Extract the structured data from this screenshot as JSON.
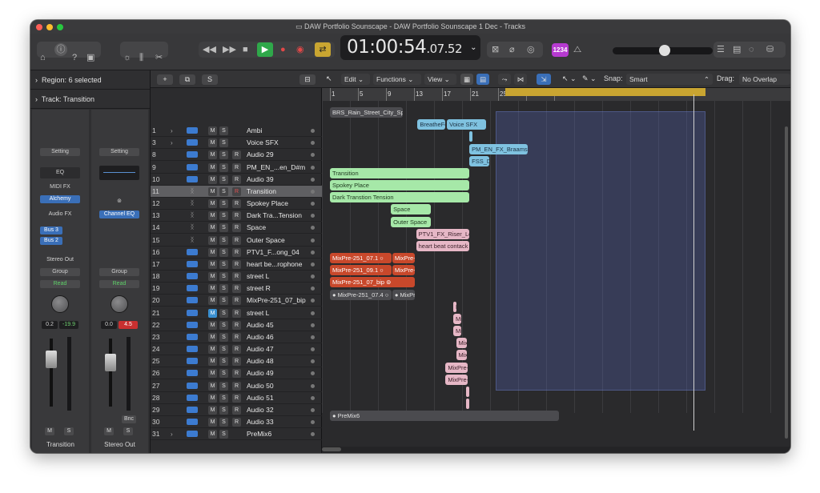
{
  "window": {
    "title": "DAW Portfolio Sounscape - DAW Portfolio Sounscape 1 Dec - Tracks"
  },
  "lcd": {
    "main": "01:00:54",
    "frames": ".07.52"
  },
  "toolbar": {
    "count_in": "1234"
  },
  "inspector": {
    "region_label": "Region:",
    "region_value": "6 selected",
    "track_label": "Track:",
    "track_value": "Transition"
  },
  "channel1": {
    "setting": "Setting",
    "eq": "EQ",
    "midi_fx": "MIDI FX",
    "instrument": "Alchemy",
    "audio_fx": "Audio FX",
    "bus1": "Bus 3",
    "bus2": "Bus 2",
    "output": "Stereo Out",
    "group": "Group",
    "auto": "Read",
    "vol": "0.2",
    "peak": "-19.9",
    "m": "M",
    "s": "S",
    "name": "Transition"
  },
  "channel2": {
    "setting": "Setting",
    "channel_eq": "Channel EQ",
    "group": "Group",
    "auto": "Read",
    "vol": "0.0",
    "peak": "4.5",
    "bnc": "Bnc",
    "m": "M",
    "s": "S",
    "name": "Stereo Out"
  },
  "header": {
    "add": "+",
    "s_btn": "S"
  },
  "control_bar": {
    "edit": "Edit",
    "functions": "Functions",
    "view": "View",
    "snap_label": "Snap:",
    "snap_value": "Smart",
    "drag_label": "Drag:",
    "drag_value": "No Overlap"
  },
  "ruler": {
    "bars": [
      "1",
      "5",
      "9",
      "13",
      "17",
      "21",
      "25",
      "29",
      "33"
    ]
  },
  "tracks": [
    {
      "num": "1",
      "name": "Ambi",
      "disc": "›",
      "type": "audio",
      "r": false,
      "ms": "M",
      "s": "S"
    },
    {
      "num": "3",
      "name": "Voice SFX",
      "disc": "›",
      "type": "audio",
      "r": false,
      "ms": "M",
      "s": "S"
    },
    {
      "num": "8",
      "name": "Audio 29",
      "disc": "",
      "type": "audio",
      "r": true,
      "ms": "M",
      "s": "S"
    },
    {
      "num": "9",
      "name": "PM_EN_...en_D#m",
      "disc": "",
      "type": "audio",
      "r": true,
      "ms": "M",
      "s": "S"
    },
    {
      "num": "10",
      "name": "Audio 39",
      "disc": "",
      "type": "audio",
      "r": true,
      "ms": "M",
      "s": "S"
    },
    {
      "num": "11",
      "name": "Transition",
      "disc": "",
      "type": "summing",
      "r": true,
      "ms": "M",
      "s": "S",
      "sel": true,
      "rred": true
    },
    {
      "num": "12",
      "name": "Spokey Place",
      "disc": "",
      "type": "summing",
      "r": true,
      "ms": "M",
      "s": "S"
    },
    {
      "num": "13",
      "name": "Dark Tra...Tension",
      "disc": "",
      "type": "summing",
      "r": true,
      "ms": "M",
      "s": "S"
    },
    {
      "num": "14",
      "name": "Space",
      "disc": "",
      "type": "summing",
      "r": true,
      "ms": "M",
      "s": "S"
    },
    {
      "num": "15",
      "name": "Outer Space",
      "disc": "",
      "type": "summing",
      "r": true,
      "ms": "M",
      "s": "S"
    },
    {
      "num": "16",
      "name": "PTV1_F...ong_04",
      "disc": "",
      "type": "audio",
      "r": true,
      "ms": "M",
      "s": "S"
    },
    {
      "num": "17",
      "name": "heart be...rophone",
      "disc": "",
      "type": "audio",
      "r": true,
      "ms": "M",
      "s": "S"
    },
    {
      "num": "18",
      "name": "street L",
      "disc": "",
      "type": "audio",
      "r": true,
      "ms": "M",
      "s": "S"
    },
    {
      "num": "19",
      "name": "street R",
      "disc": "",
      "type": "audio",
      "r": true,
      "ms": "M",
      "s": "S"
    },
    {
      "num": "20",
      "name": "MixPre-251_07_bip",
      "disc": "",
      "type": "audio",
      "r": true,
      "ms": "M",
      "s": "S"
    },
    {
      "num": "21",
      "name": "street L",
      "disc": "",
      "type": "audio",
      "r": true,
      "ms": "M",
      "s": "S",
      "mon": true
    },
    {
      "num": "22",
      "name": "Audio 45",
      "disc": "",
      "type": "audio",
      "r": true,
      "ms": "M",
      "s": "S"
    },
    {
      "num": "23",
      "name": "Audio 46",
      "disc": "",
      "type": "audio",
      "r": true,
      "ms": "M",
      "s": "S"
    },
    {
      "num": "24",
      "name": "Audio 47",
      "disc": "",
      "type": "audio",
      "r": true,
      "ms": "M",
      "s": "S"
    },
    {
      "num": "25",
      "name": "Audio 48",
      "disc": "",
      "type": "audio",
      "r": true,
      "ms": "M",
      "s": "S"
    },
    {
      "num": "26",
      "name": "Audio 49",
      "disc": "",
      "type": "audio",
      "r": true,
      "ms": "M",
      "s": "S"
    },
    {
      "num": "27",
      "name": "Audio 50",
      "disc": "",
      "type": "audio",
      "r": true,
      "ms": "M",
      "s": "S"
    },
    {
      "num": "28",
      "name": "Audio 51",
      "disc": "",
      "type": "audio",
      "r": true,
      "ms": "M",
      "s": "S"
    },
    {
      "num": "29",
      "name": "Audio 32",
      "disc": "",
      "type": "audio",
      "r": true,
      "ms": "M",
      "s": "S"
    },
    {
      "num": "30",
      "name": "Audio 33",
      "disc": "",
      "type": "audio",
      "r": true,
      "ms": "M",
      "s": "S"
    },
    {
      "num": "31",
      "name": "PreMix6",
      "disc": "›",
      "type": "audio",
      "r": false,
      "ms": "M",
      "s": "S"
    }
  ],
  "regions": [
    {
      "row": 0,
      "start": 1,
      "end": 11.5,
      "label": "BRS_Rain_Street_City_Splatty_4 ⊚",
      "color": "grey"
    },
    {
      "row": 1,
      "start": 13.5,
      "end": 17.6,
      "label": "BreatheFemale_ZA0",
      "color": "blue"
    },
    {
      "row": 1,
      "start": 17.7,
      "end": 23.4,
      "label": "Voice SFX",
      "color": "blue"
    },
    {
      "row": 2,
      "start": 20.9,
      "end": 21.4,
      "label": "",
      "color": "blue"
    },
    {
      "row": 3,
      "start": 20.9,
      "end": 29.3,
      "label": "PM_EN_FX_Braams_One_Shot_Siren_",
      "color": "blue"
    },
    {
      "row": 4,
      "start": 20.9,
      "end": 23.8,
      "label": "FSS_DPTE",
      "color": "blue"
    },
    {
      "row": 5,
      "start": 1,
      "end": 21,
      "label": "Transition",
      "color": "green"
    },
    {
      "row": 6,
      "start": 1,
      "end": 21,
      "label": "Spokey Place",
      "color": "green"
    },
    {
      "row": 7,
      "start": 1,
      "end": 21,
      "label": "Dark Transtion Tension",
      "color": "green"
    },
    {
      "row": 8,
      "start": 9.7,
      "end": 15.5,
      "label": "Space",
      "color": "green"
    },
    {
      "row": 9,
      "start": 9.7,
      "end": 15.5,
      "label": "Outer Space",
      "color": "green"
    },
    {
      "row": 10,
      "start": 13.3,
      "end": 21,
      "label": "PTV1_FX_Riser_Long_04 ⊚",
      "color": "pink"
    },
    {
      "row": 11,
      "start": 13.3,
      "end": 21,
      "label": "heart beat contack microphone",
      "color": "pink"
    },
    {
      "row": 12,
      "start": 1,
      "end": 9.9,
      "label": "MixPre-251_07.1 ○",
      "color": "red"
    },
    {
      "row": 12,
      "start": 9.9,
      "end": 13.2,
      "label": "MixPre-25",
      "color": "red"
    },
    {
      "row": 13,
      "start": 1,
      "end": 9.9,
      "label": "MixPre-251_09.1 ○",
      "color": "red"
    },
    {
      "row": 13,
      "start": 9.9,
      "end": 13.2,
      "label": "MixPre-25",
      "color": "red"
    },
    {
      "row": 14,
      "start": 1,
      "end": 13.2,
      "label": "MixPre-251_07_bip ⊚",
      "color": "red"
    },
    {
      "row": 15,
      "start": 1,
      "end": 9.9,
      "label": "● MixPre-251_07.4 ○",
      "color": "grey"
    },
    {
      "row": 15,
      "start": 9.9,
      "end": 13.2,
      "label": "● MixPre-",
      "color": "grey"
    },
    {
      "row": 16,
      "start": 18.6,
      "end": 19.2,
      "label": "Mi",
      "color": "pink"
    },
    {
      "row": 17,
      "start": 18.6,
      "end": 19.9,
      "label": "MixPr",
      "color": "pink"
    },
    {
      "row": 18,
      "start": 18.6,
      "end": 19.9,
      "label": "MixPr",
      "color": "pink"
    },
    {
      "row": 19,
      "start": 19.0,
      "end": 20.6,
      "label": "MixPre",
      "color": "pink"
    },
    {
      "row": 20,
      "start": 19.0,
      "end": 20.6,
      "label": "MixPre",
      "color": "pink"
    },
    {
      "row": 21,
      "start": 17.5,
      "end": 20.8,
      "label": "MixPre-257_07.",
      "color": "pink"
    },
    {
      "row": 22,
      "start": 17.5,
      "end": 20.8,
      "label": "MixPre-257_09.",
      "color": "pink"
    },
    {
      "row": 23,
      "start": 20.4,
      "end": 20.9,
      "label": "",
      "color": "pink"
    },
    {
      "row": 24,
      "start": 20.4,
      "end": 20.9,
      "label": "",
      "color": "pink"
    },
    {
      "row": 25,
      "start": 1,
      "end": 33.8,
      "label": "● PreMix6",
      "color": "grey"
    }
  ]
}
